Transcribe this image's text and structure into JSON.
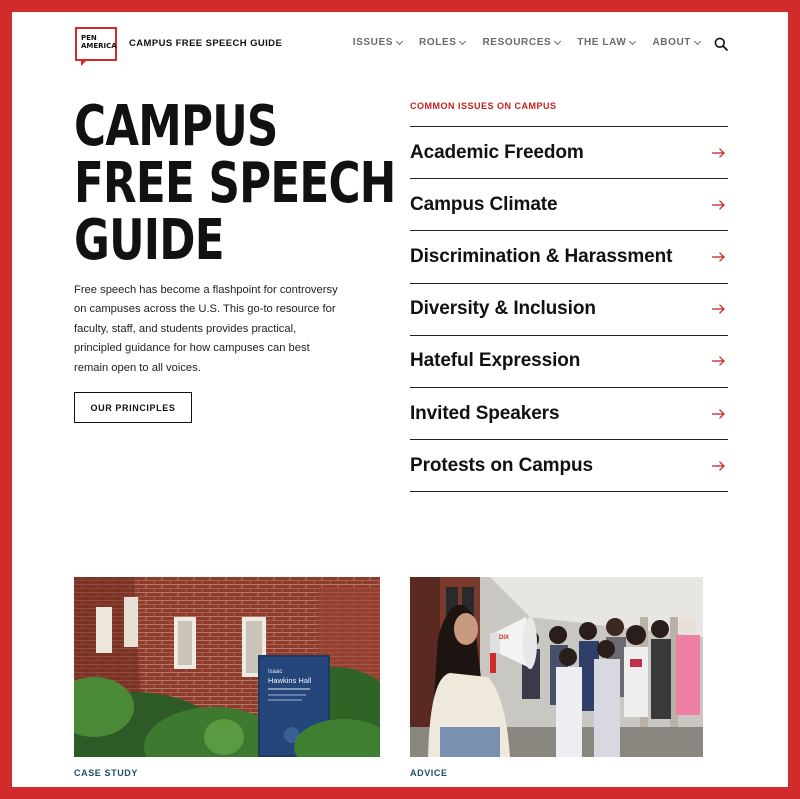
{
  "header": {
    "logo_line1": "PEN",
    "logo_line2": "AMERICA",
    "site_name": "CAMPUS FREE SPEECH GUIDE",
    "nav": [
      "ISSUES",
      "ROLES",
      "RESOURCES",
      "THE LAW",
      "ABOUT"
    ],
    "search_icon": "search-icon"
  },
  "hero": {
    "title_lines": [
      "CAMPUS",
      "FREE SPEECH",
      "GUIDE"
    ],
    "description": "Free speech has become a flashpoint for controversy on campuses across the U.S. This go-to resource for faculty, staff, and students provides practical, principled guidance for how campuses can best remain open to all voices.",
    "button_label": "OUR PRINCIPLES"
  },
  "issues": {
    "label": "COMMON ISSUES ON CAMPUS",
    "items": [
      "Academic Freedom",
      "Campus Climate",
      "Discrimination & Harassment",
      "Diversity & Inclusion",
      "Hateful Expression",
      "Invited Speakers",
      "Protests on Campus"
    ]
  },
  "cards": [
    {
      "label": "CASE STUDY",
      "sign_line1": "Isaac",
      "sign_line2": "Hawkins Hall"
    },
    {
      "label": "ADVICE",
      "megaphone_text": "DIX"
    }
  ],
  "colors": {
    "frame": "#d12b2b",
    "accent_red": "#c41e1e",
    "card_label": "#1c4f63"
  }
}
